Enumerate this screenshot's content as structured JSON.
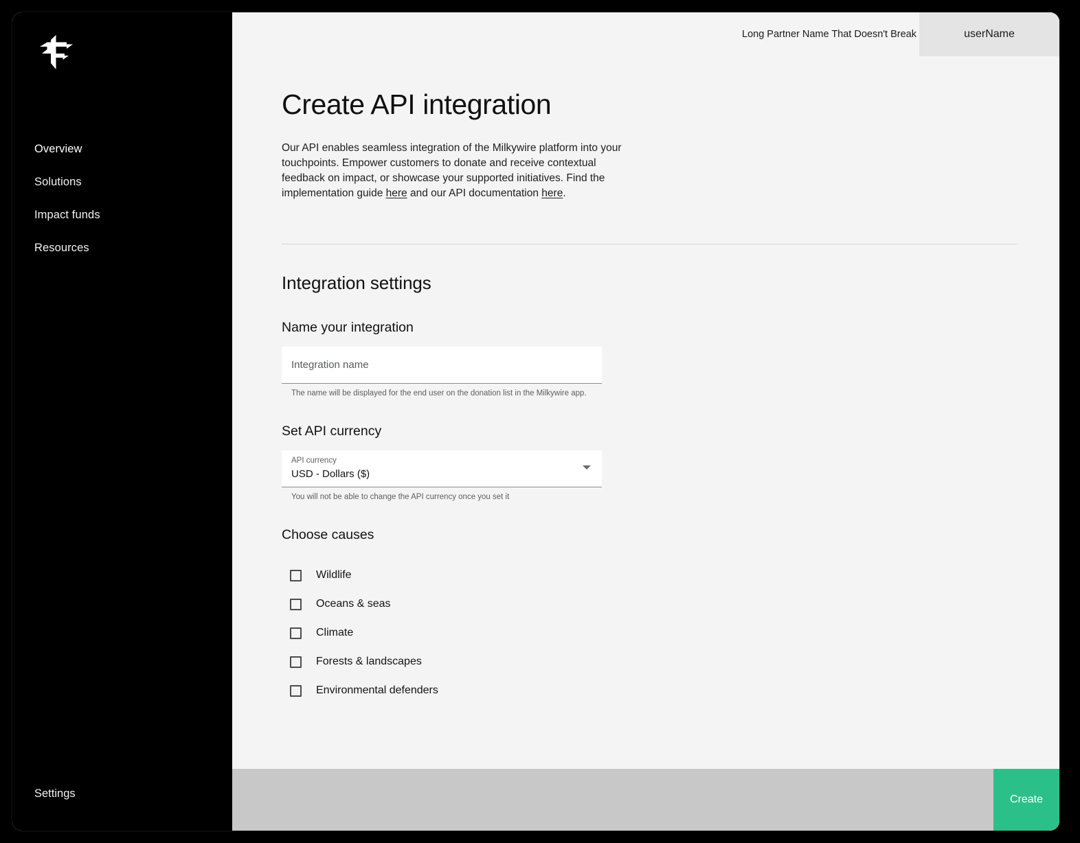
{
  "sidebar": {
    "logo_icon": "milkywire-arrow-logo",
    "items": [
      {
        "label": "Overview",
        "active": true
      },
      {
        "label": "Solutions",
        "active": false
      },
      {
        "label": "Impact funds",
        "active": false
      },
      {
        "label": "Resources",
        "active": false
      }
    ],
    "settings_label": "Settings"
  },
  "header": {
    "partner_name": "Long Partner Name That Doesn't Break",
    "user_name": "userName"
  },
  "page": {
    "title": "Create API integration",
    "intro_part1": "Our API enables seamless integration of the Milkywire platform into your touchpoints. Empower customers to donate and receive contextual feedback on impact, or showcase your supported initiatives. Find the implementation guide ",
    "intro_link1": "here",
    "intro_part2": " and our API documentation ",
    "intro_link2": "here",
    "intro_part3": "."
  },
  "settings_section": {
    "title": "Integration settings",
    "name_field": {
      "label": "Name your integration",
      "placeholder": "Integration name",
      "value": "",
      "helper": "The name will be displayed for the end user on the donation list in the Milkywire app."
    },
    "currency_field": {
      "label": "Set API currency",
      "caption": "API currency",
      "value": "USD - Dollars ($)",
      "helper": "You will not be able to change the API currency once you set it",
      "caret_icon": "chevron-down-icon"
    },
    "causes": {
      "label": "Choose causes",
      "items": [
        {
          "label": "Wildlife",
          "checked": false
        },
        {
          "label": "Oceans & seas",
          "checked": false
        },
        {
          "label": "Climate",
          "checked": false
        },
        {
          "label": "Forests & landscapes",
          "checked": false
        },
        {
          "label": "Environmental defenders",
          "checked": false
        }
      ]
    }
  },
  "footer": {
    "create_label": "Create"
  },
  "colors": {
    "sidebar_bg": "#000000",
    "content_bg": "#f4f4f4",
    "footer_bg": "#c8c8c8",
    "accent_green": "#2bc08a",
    "user_chip_bg": "#e4e4e4"
  }
}
